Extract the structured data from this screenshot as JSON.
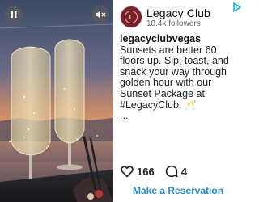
{
  "account": {
    "name": "Legacy Club",
    "followers": "18.4k followers",
    "avatar_monogram": "L"
  },
  "post": {
    "handle": "legacyclubvegas",
    "caption": "Sunsets are better 60 floors up. Sip, toast, and snack your way through golden hour with our Sunset Package at #LegacyClub. 🥂",
    "more": "..."
  },
  "stats": {
    "likes": "166",
    "comments": "4"
  },
  "cta": {
    "label": "Make a Reservation"
  },
  "icons": {
    "pause": "pause-icon",
    "mute": "mute-icon",
    "adchoices": "adchoices-icon",
    "heart": "heart-icon",
    "comment": "comment-icon"
  },
  "colors": {
    "link_blue": "#2a89c7",
    "adchoices_cyan": "#00a9e0",
    "avatar_burgundy": "#7a1f2e"
  }
}
